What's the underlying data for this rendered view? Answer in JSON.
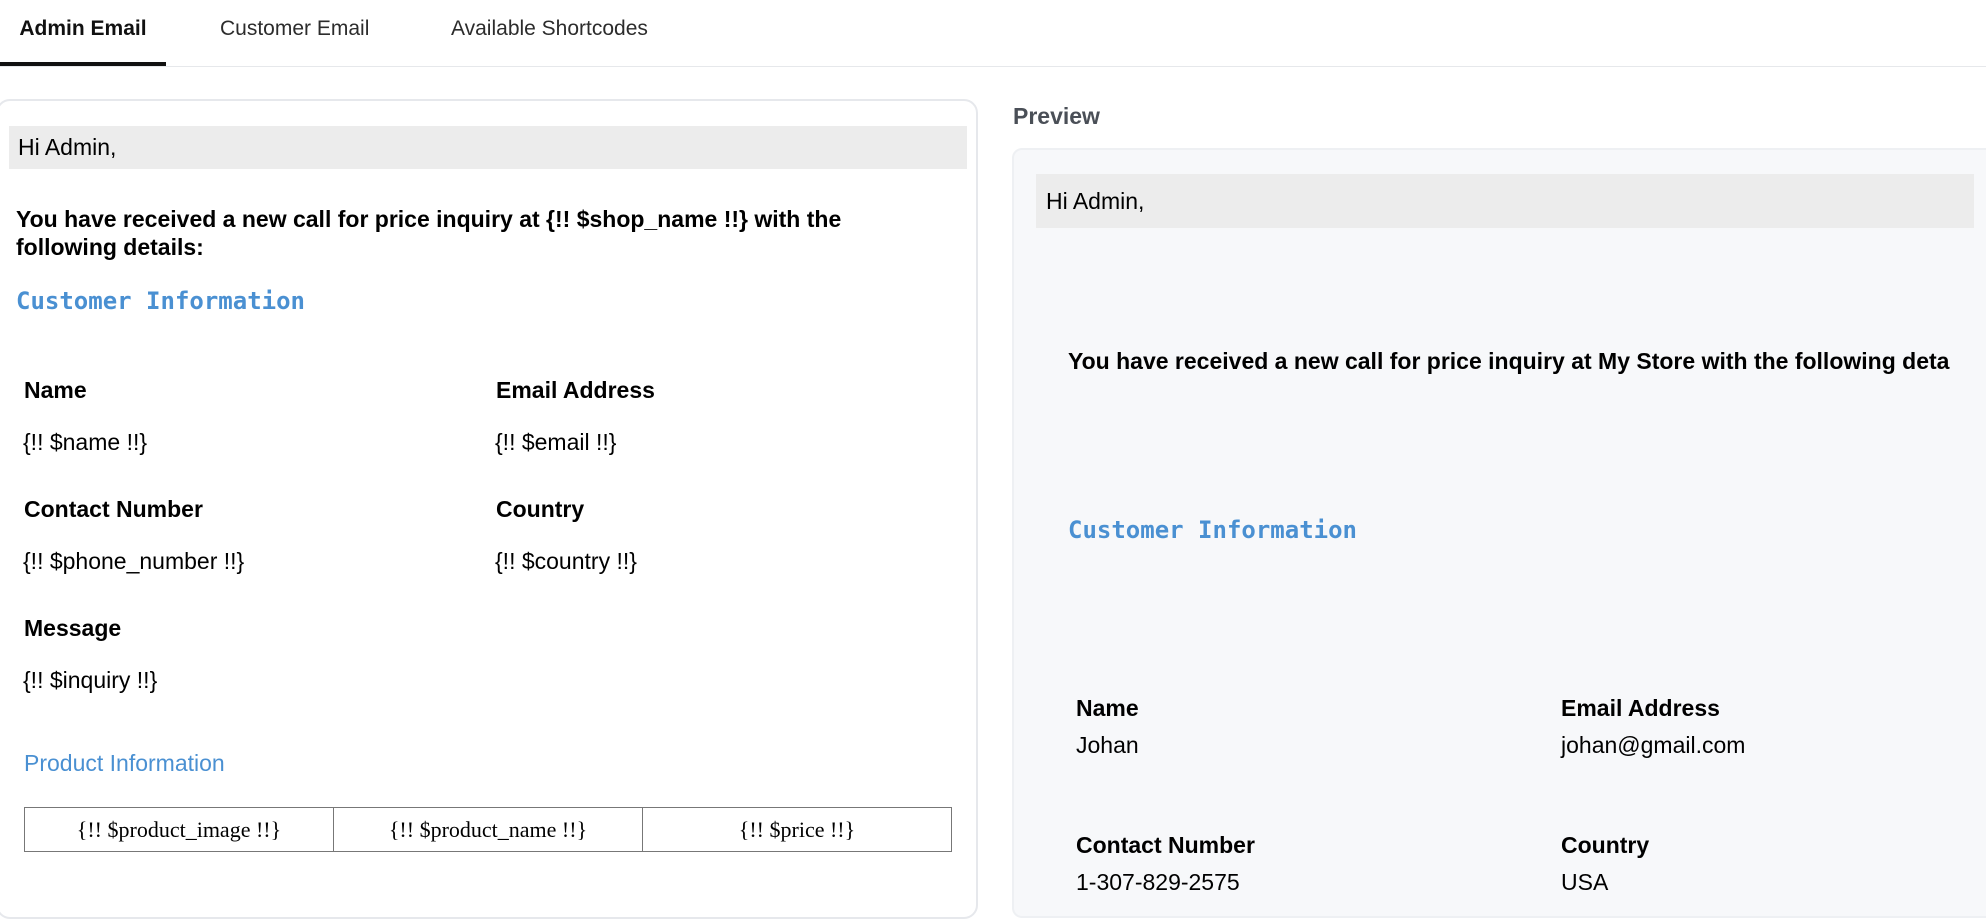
{
  "tabs": [
    {
      "label": "Admin Email",
      "active": true
    },
    {
      "label": "Customer Email",
      "active": false
    },
    {
      "label": "Available Shortcodes",
      "active": false
    }
  ],
  "editor": {
    "greeting": "Hi Admin,",
    "intro": "You have received a new call for price inquiry at {!! $shop_name !!} with the following details:",
    "customer_heading": "Customer Information",
    "fields": {
      "name_label": "Name",
      "name_value": "{!! $name !!}",
      "email_label": "Email Address",
      "email_value": "{!! $email !!}",
      "phone_label": "Contact Number",
      "phone_value": "{!! $phone_number !!}",
      "country_label": "Country",
      "country_value": "{!! $country !!}",
      "message_label": "Message",
      "message_value": "{!! $inquiry !!}"
    },
    "product_heading": "Product Information",
    "product_table": [
      "{!! $product_image !!}",
      "{!! $product_name !!}",
      "{!! $price !!}"
    ]
  },
  "preview": {
    "label": "Preview",
    "greeting": "Hi Admin,",
    "intro": "You have received a new call for price inquiry at My Store with the following deta",
    "customer_heading": "Customer Information",
    "fields": {
      "name_label": "Name",
      "name_value": "Johan",
      "email_label": "Email Address",
      "email_value": "johan@gmail.com",
      "phone_label": "Contact Number",
      "phone_value": "1-307-829-2575",
      "country_label": "Country",
      "country_value": "USA"
    }
  },
  "colors": {
    "accent": "#4a90d2",
    "greeting_bg": "#ececec",
    "preview_bg": "#f7f8fa"
  }
}
